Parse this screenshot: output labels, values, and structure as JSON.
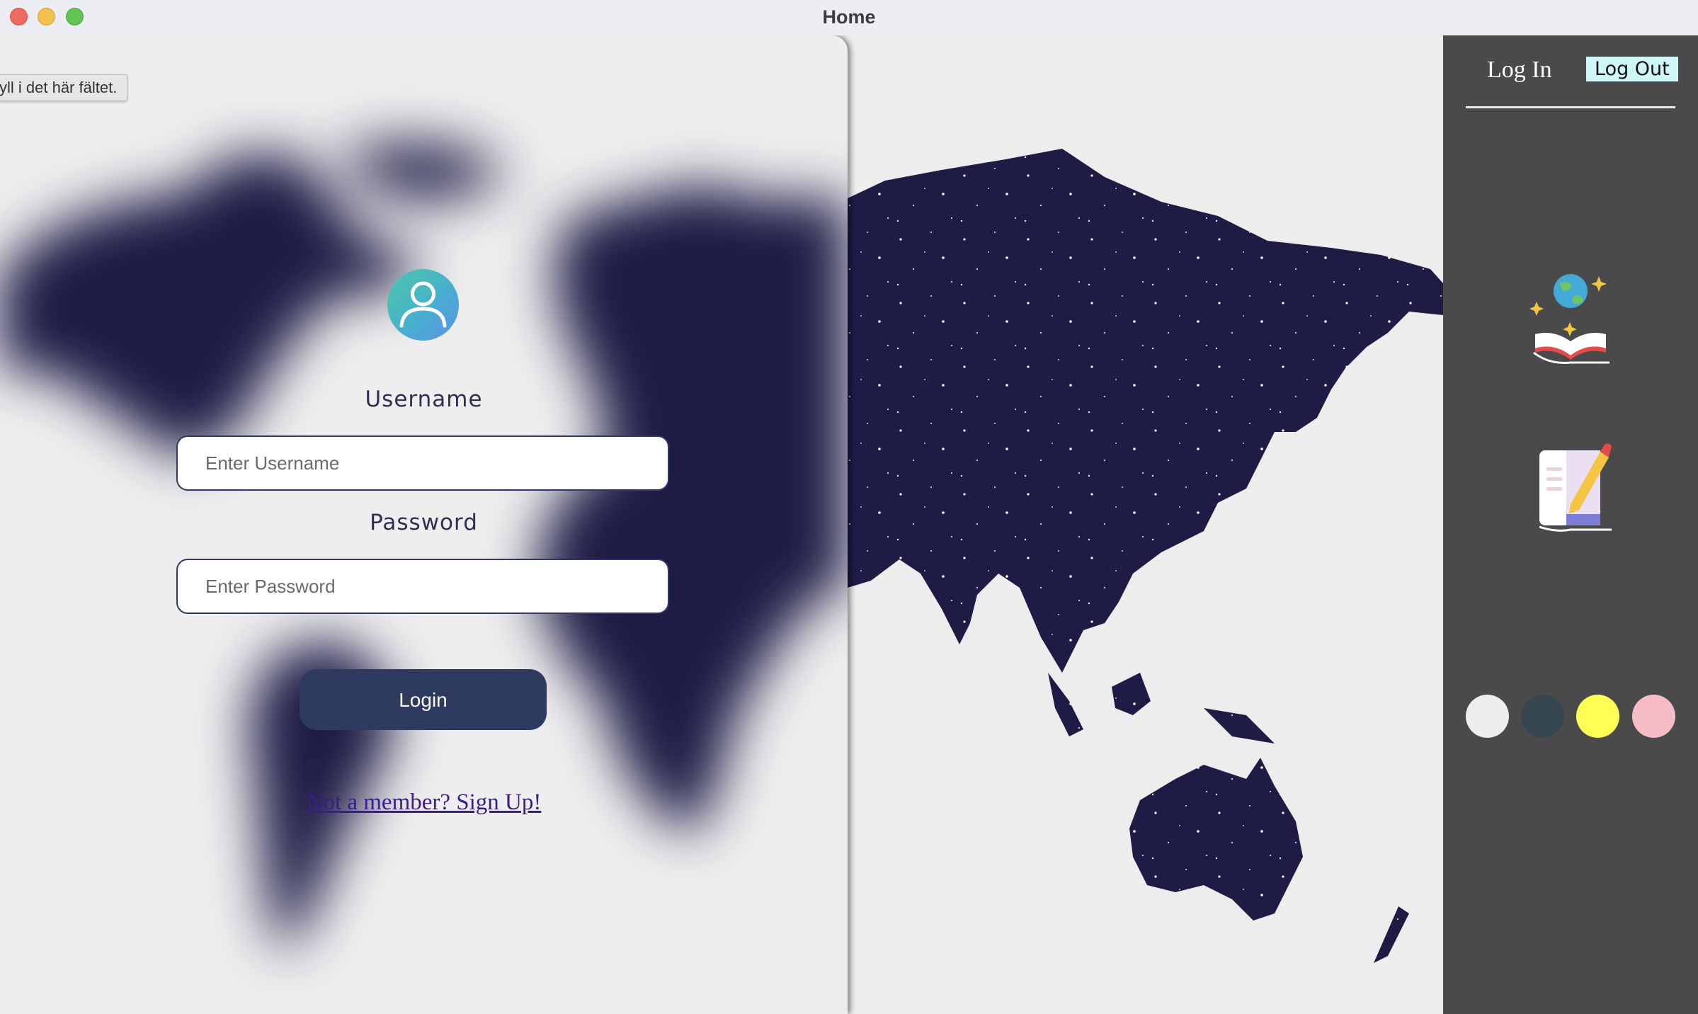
{
  "window": {
    "title": "Home"
  },
  "tooltip": {
    "text": "yll i det här fältet."
  },
  "login": {
    "username_label": "Username",
    "username_placeholder": "Enter Username",
    "password_label": "Password",
    "password_placeholder": "Enter Password",
    "login_button": "Login",
    "signup_link": "Not a member? Sign Up!"
  },
  "sidebar": {
    "login_label": "Log In",
    "logout_label": "Log Out",
    "icons": [
      "globe-book-icon",
      "notebook-pencil-icon"
    ],
    "swatches": [
      "#eeeeee",
      "#37474f",
      "#ffff55",
      "#f7bdc7"
    ]
  },
  "colors": {
    "accent": "#2f3a60",
    "map": "#1e1c45",
    "sidebar": "#4a4a4a",
    "logout_bg": "#cff7f7"
  }
}
